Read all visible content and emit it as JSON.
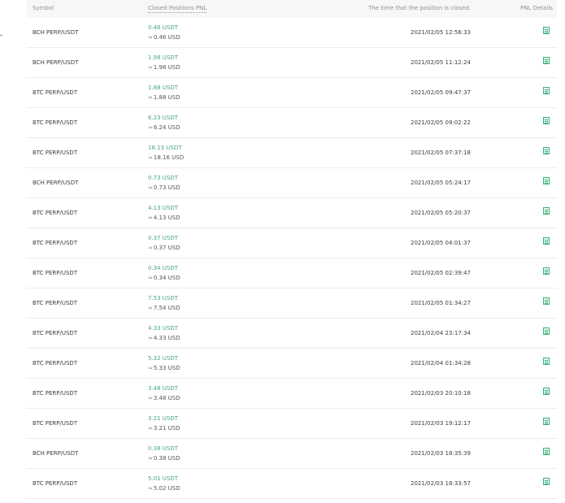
{
  "table": {
    "headers": {
      "symbol": "Symbol",
      "pnl": "Closed Positions PNL",
      "time": "The time that the position is closed.",
      "details": "PNL Details"
    },
    "approx_symbol": "≈",
    "rows": [
      {
        "symbol": "BCH PERP/USDT",
        "pnl_usdt": "0.46 USDT",
        "pnl_usd": "0.46 USD",
        "time": "2021/02/05 12:56:33"
      },
      {
        "symbol": "BCH PERP/USDT",
        "pnl_usdt": "1.98 USDT",
        "pnl_usd": "1.98 USD",
        "time": "2021/02/05 11:12:24"
      },
      {
        "symbol": "BTC PERP/USDT",
        "pnl_usdt": "1.88 USDT",
        "pnl_usd": "1.88 USD",
        "time": "2021/02/05 09:47:37"
      },
      {
        "symbol": "BTC PERP/USDT",
        "pnl_usdt": "6.23 USDT",
        "pnl_usd": "6.24 USD",
        "time": "2021/02/05 09:02:22"
      },
      {
        "symbol": "BTC PERP/USDT",
        "pnl_usdt": "18.13 USDT",
        "pnl_usd": "18.16 USD",
        "time": "2021/02/05 07:37:18"
      },
      {
        "symbol": "BCH PERP/USDT",
        "pnl_usdt": "0.73 USDT",
        "pnl_usd": "0.73 USD",
        "time": "2021/02/05 05:24:17"
      },
      {
        "symbol": "BTC PERP/USDT",
        "pnl_usdt": "4.13 USDT",
        "pnl_usd": "4.13 USD",
        "time": "2021/02/05 05:20:37"
      },
      {
        "symbol": "BTC PERP/USDT",
        "pnl_usdt": "0.37 USDT",
        "pnl_usd": "0.37 USD",
        "time": "2021/02/05 04:01:37"
      },
      {
        "symbol": "BTC PERP/USDT",
        "pnl_usdt": "0.34 USDT",
        "pnl_usd": "0.34 USD",
        "time": "2021/02/05 02:39:47"
      },
      {
        "symbol": "BTC PERP/USDT",
        "pnl_usdt": "7.53 USDT",
        "pnl_usd": "7.54 USD",
        "time": "2021/02/05 01:34:27"
      },
      {
        "symbol": "BTC PERP/USDT",
        "pnl_usdt": "4.33 USDT",
        "pnl_usd": "4.33 USD",
        "time": "2021/02/04 23:17:34"
      },
      {
        "symbol": "BTC PERP/USDT",
        "pnl_usdt": "5.32 USDT",
        "pnl_usd": "5.33 USD",
        "time": "2021/02/04 01:34:28"
      },
      {
        "symbol": "BTC PERP/USDT",
        "pnl_usdt": "3.48 USDT",
        "pnl_usd": "3.48 USD",
        "time": "2021/02/03 20:10:18"
      },
      {
        "symbol": "BTC PERP/USDT",
        "pnl_usdt": "3.21 USDT",
        "pnl_usd": "3.21 USD",
        "time": "2021/02/03 19:12:17"
      },
      {
        "symbol": "BCH PERP/USDT",
        "pnl_usdt": "0.38 USDT",
        "pnl_usd": "0.38 USD",
        "time": "2021/02/03 18:35:39"
      },
      {
        "symbol": "BTC PERP/USDT",
        "pnl_usdt": "5.01 USDT",
        "pnl_usd": "5.02 USD",
        "time": "2021/02/03 18:33:57"
      }
    ],
    "detail_icon": "document-icon",
    "colors": {
      "profit": "#47a77a",
      "header_bg": "#f7f7f7",
      "row_border": "#ececec",
      "icon_accent": "#3bb27e"
    }
  }
}
